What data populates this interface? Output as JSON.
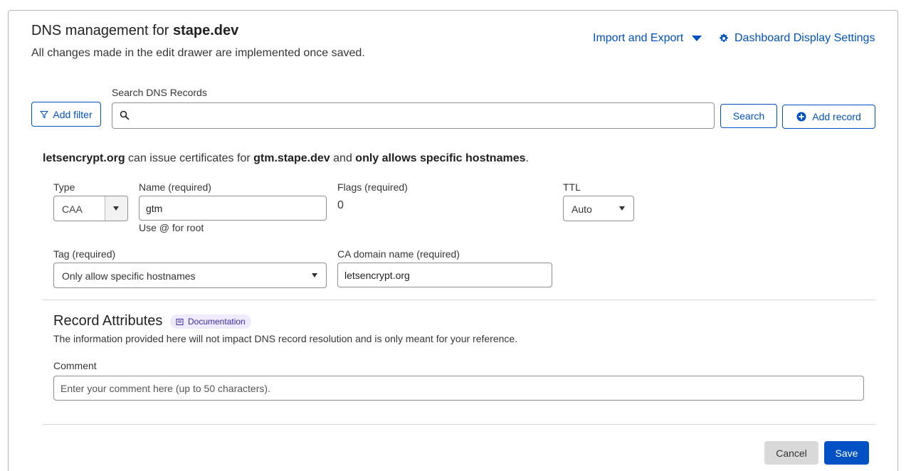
{
  "header": {
    "title_prefix": "DNS management for ",
    "title_domain": "stape.dev",
    "subtitle": "All changes made in the edit drawer are implemented once saved.",
    "import_export_label": "Import and Export",
    "dashboard_settings_label": "Dashboard Display Settings"
  },
  "search": {
    "label": "Search DNS Records",
    "value": "",
    "button_label": "Search"
  },
  "toolbar": {
    "add_filter_label": "Add filter",
    "add_record_label": "Add record"
  },
  "summary": {
    "ca": "letsencrypt.org",
    "t1": " can issue certificates for ",
    "host": "gtm.stape.dev",
    "t2": " and ",
    "policy": "only allows specific hostnames",
    "t3": "."
  },
  "record_form": {
    "type_label": "Type",
    "type_value": "CAA",
    "name_label": "Name (required)",
    "name_value": "gtm",
    "name_hint": "Use @ for root",
    "flags_label": "Flags (required)",
    "flags_value": "0",
    "ttl_label": "TTL",
    "ttl_value": "Auto",
    "tag_label": "Tag (required)",
    "tag_value": "Only allow specific hostnames",
    "ca_label": "CA domain name (required)",
    "ca_value": "letsencrypt.org"
  },
  "attributes": {
    "title": "Record Attributes",
    "doc_badge": "Documentation",
    "description": "The information provided here will not impact DNS record resolution and is only meant for your reference.",
    "comment_label": "Comment",
    "comment_value": "",
    "comment_placeholder": "Enter your comment here (up to 50 characters)."
  },
  "footer": {
    "cancel_label": "Cancel",
    "save_label": "Save"
  },
  "colors": {
    "accent": "#0051c3",
    "badge_bg": "#efeafd",
    "cancel_bg": "#d9d9d9"
  },
  "icons": [
    "gear-icon",
    "filter-icon",
    "search-icon",
    "plus-circle-icon",
    "book-icon",
    "caret-down-icon"
  ]
}
